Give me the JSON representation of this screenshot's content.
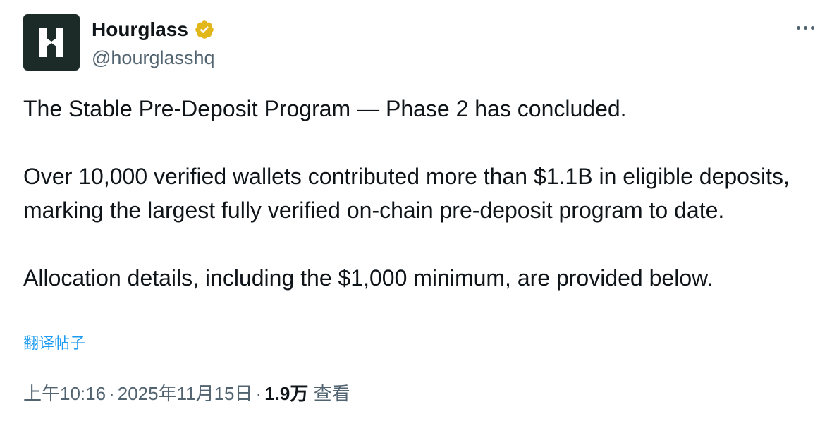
{
  "author": {
    "display_name": "Hourglass",
    "handle": "@hourglasshq",
    "avatar_icon": "hourglass-logo-icon",
    "verified_icon": "verified-badge-icon",
    "verified_color": "#e2b719"
  },
  "more_icon": "more-options-icon",
  "tweet": {
    "paragraphs": [
      "The Stable Pre-Deposit Program — Phase 2 has concluded.",
      "Over 10,000 verified wallets contributed more than $1.1B in eligible deposits, marking the largest fully verified on-chain pre-deposit program to date.",
      "Allocation details, including the $1,000 minimum, are provided below."
    ],
    "translate_label": "翻译帖子"
  },
  "meta": {
    "time": "上午10:16",
    "separator": "·",
    "date": "2025年11月15日",
    "views_count": "1.9万",
    "views_label": "查看"
  },
  "colors": {
    "text": "#0f1419",
    "secondary": "#536471",
    "link": "#1d9bf0",
    "avatar_bg": "#1c2b27"
  }
}
